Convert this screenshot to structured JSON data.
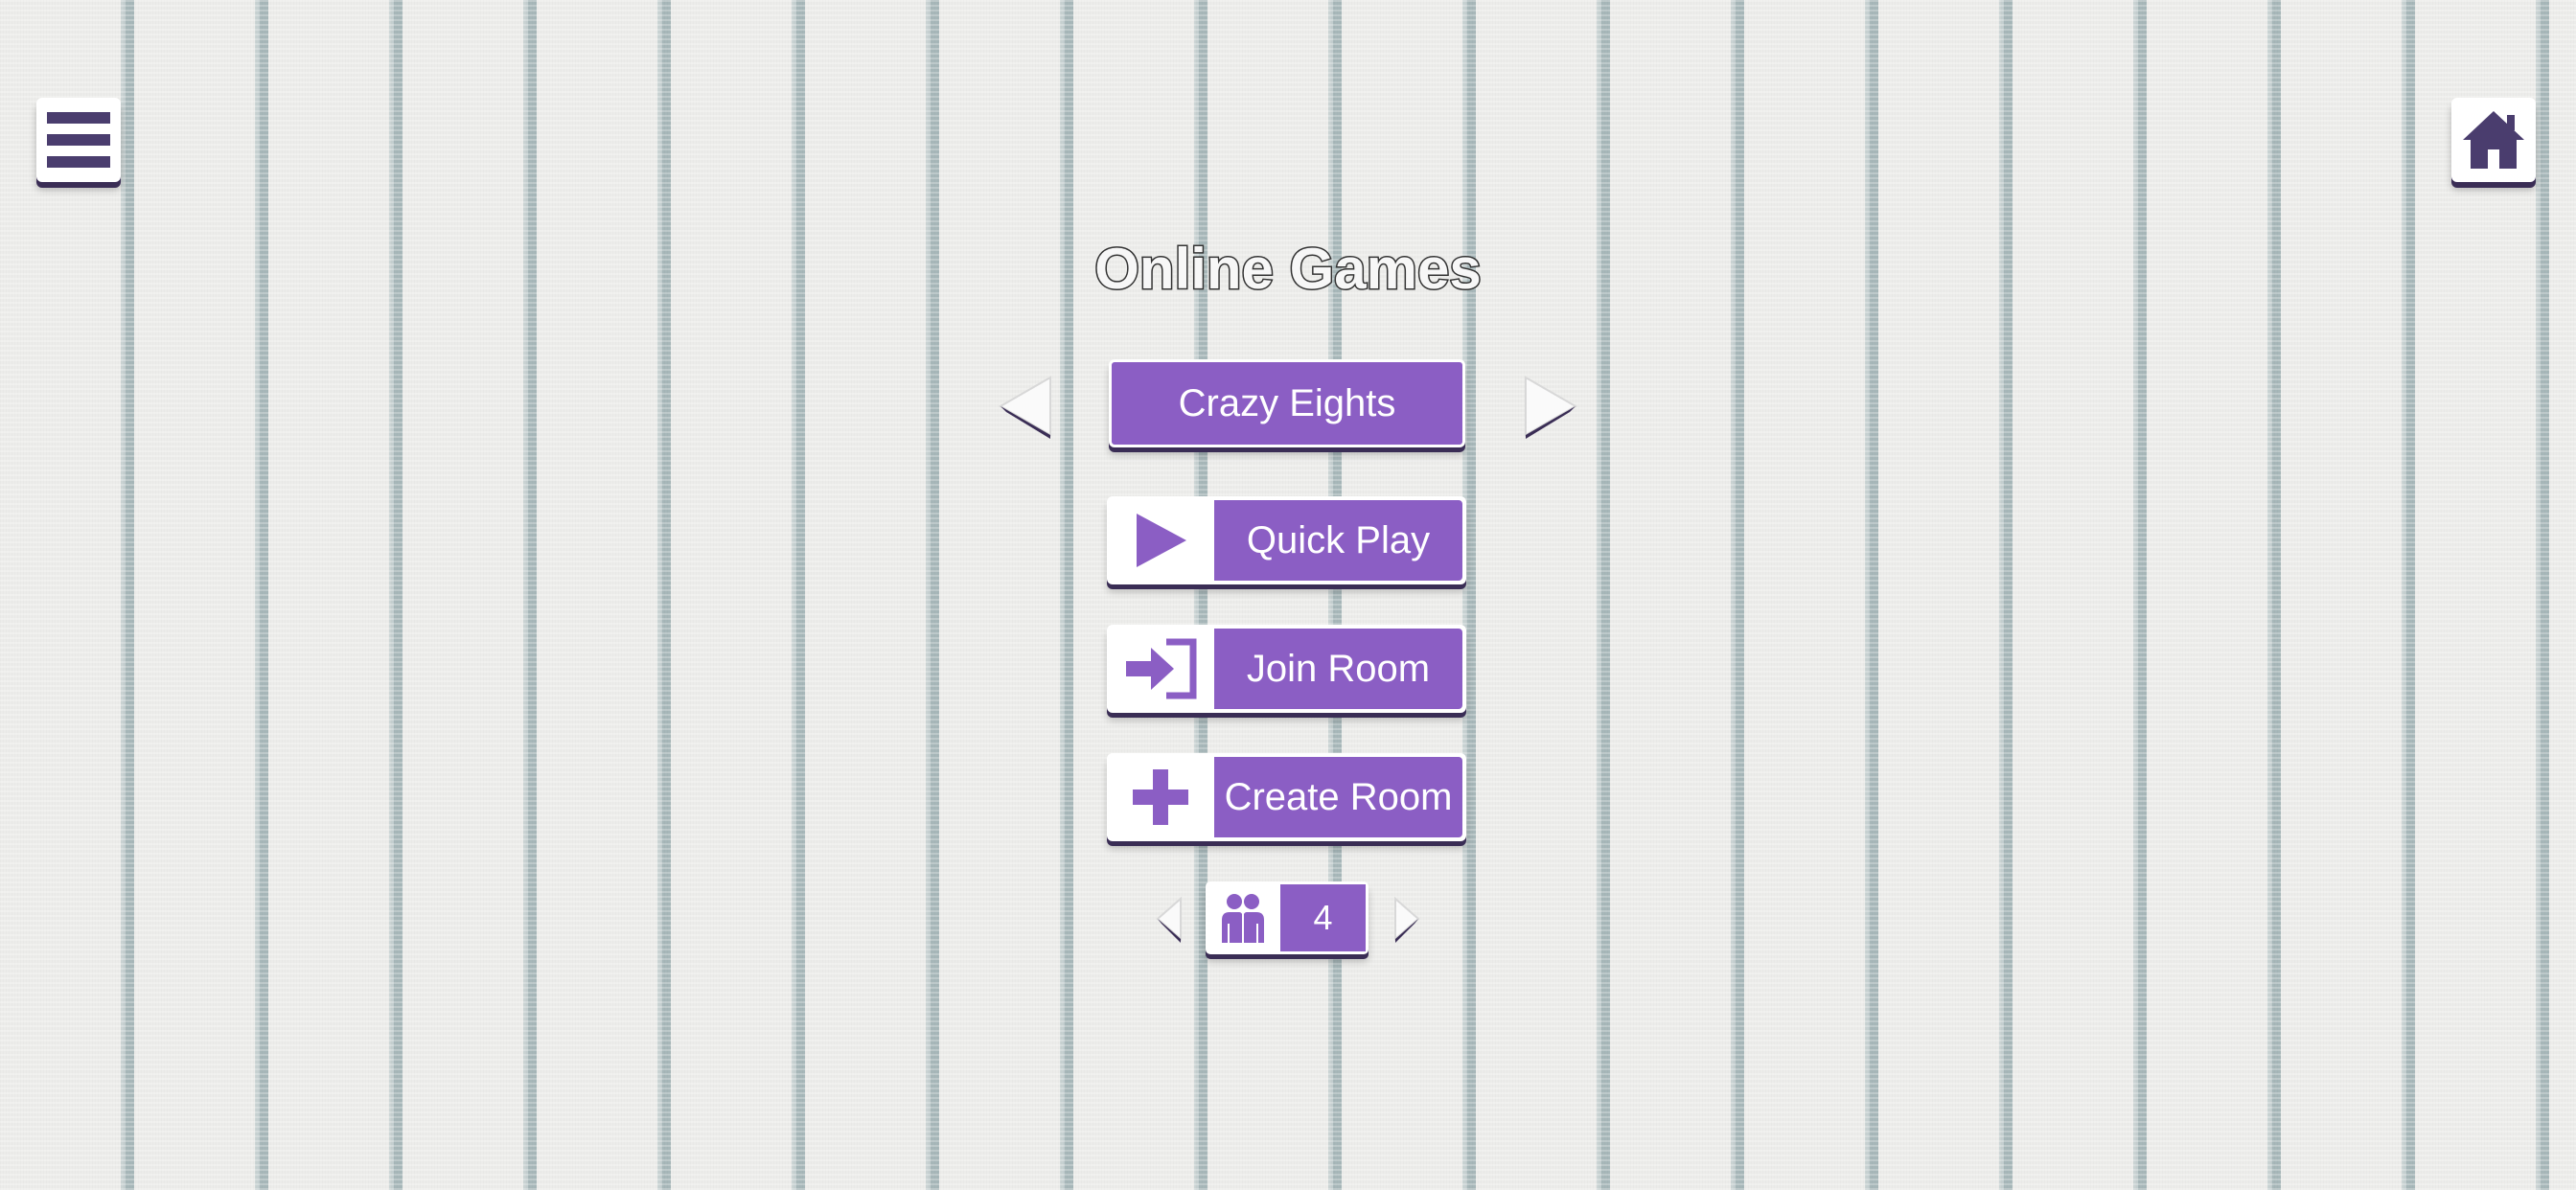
{
  "header": {
    "menu_icon": "hamburger-menu-icon",
    "home_icon": "home-icon"
  },
  "title": "Online Games",
  "game_selector": {
    "selected_game": "Crazy Eights",
    "prev_icon": "triangle-left-icon",
    "next_icon": "triangle-right-icon"
  },
  "actions": {
    "quick_play": {
      "label": "Quick Play",
      "icon": "play-icon"
    },
    "join_room": {
      "label": "Join Room",
      "icon": "sign-in-icon"
    },
    "create_room": {
      "label": "Create Room",
      "icon": "plus-icon"
    }
  },
  "players": {
    "count": "4",
    "icon": "players-icon"
  },
  "colors": {
    "accent": "#8b5ec4",
    "dark": "#4a3d6e",
    "shadow": "#3a2d55",
    "background": "#ececea",
    "stripe": "#a7b7b9"
  }
}
